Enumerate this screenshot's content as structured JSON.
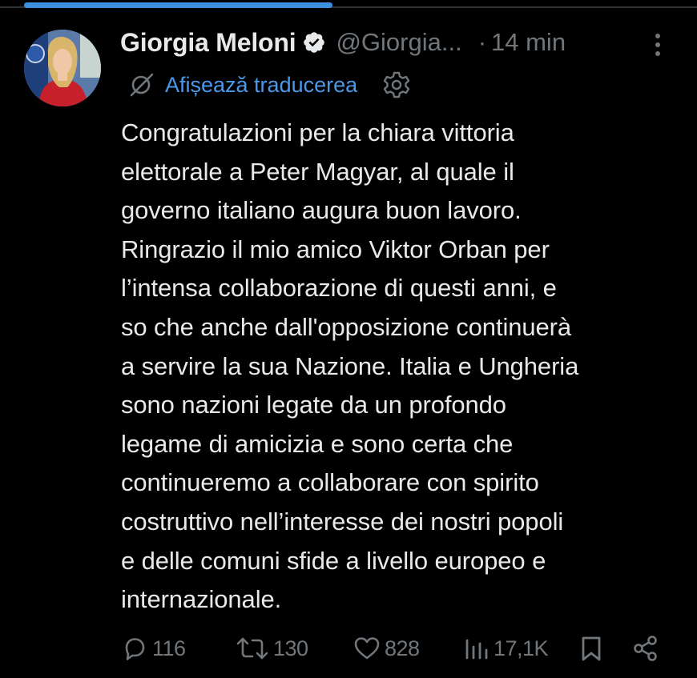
{
  "tweet": {
    "author": {
      "display_name": "Giorgia Meloni",
      "handle": "@Giorgia...",
      "verified": true
    },
    "separator": "·",
    "timestamp": "14 min",
    "translate_label": "Afișează traducerea",
    "text": "Congratulazioni per la chiara vittoria\nelettorale a Peter Magyar, al quale il\ngoverno italiano augura buon lavoro.\nRingrazio il mio amico Viktor Orban per\nl’intensa collaborazione di questi anni, e\nso che anche dall'opposizione continuerà\na servire la sua Nazione. Italia e Ungheria\nsono nazioni legate da un profondo\nlegame di amicizia e sono certa che\ncontinueremo a collaborare con spirito\ncostruttivo nell’interesse dei nostri popoli\ne delle comuni sfide a livello europeo e\ninternazionale.",
    "stats": {
      "replies": "116",
      "reposts": "130",
      "likes": "828",
      "views": "17,1K"
    }
  },
  "icons": {
    "verified": "verified-badge-icon",
    "more": "more-vertical-icon",
    "translate": "translate-icon",
    "settings": "gear-icon",
    "reply": "reply-icon",
    "repost": "repost-icon",
    "like": "heart-icon",
    "views": "views-icon",
    "bookmark": "bookmark-icon",
    "share": "share-icon"
  },
  "colors": {
    "background": "#000000",
    "text_primary": "#e7e9ea",
    "text_secondary": "#71767b",
    "link": "#4a99e9",
    "progress": "#3d8fe0"
  },
  "loading_progress": 0.44
}
